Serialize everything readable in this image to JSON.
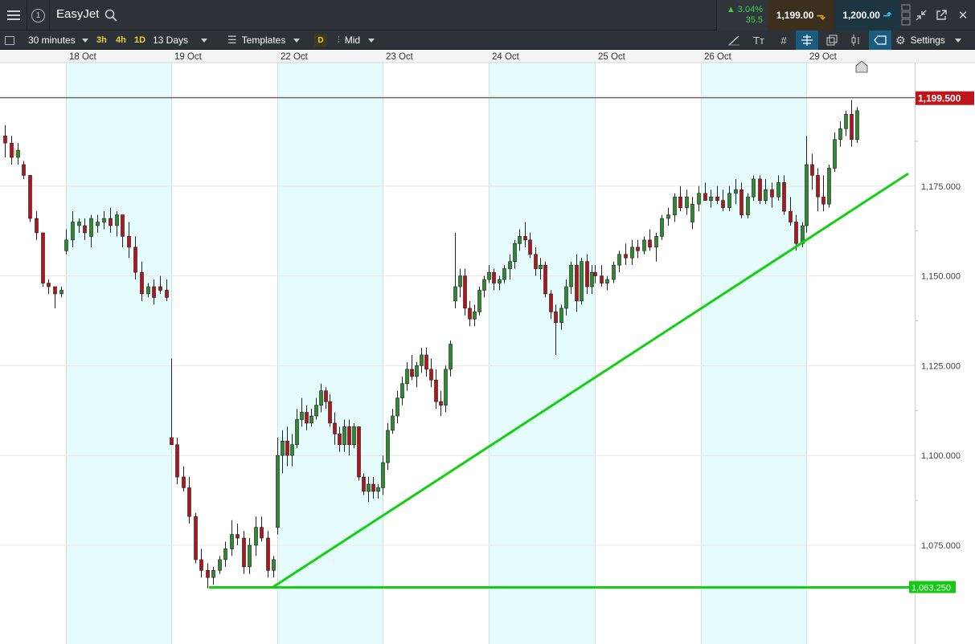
{
  "header": {
    "instrument": "EasyJet",
    "info_label": "1",
    "change_pct": "▲ 3.04%",
    "change_pts": "35.5",
    "sell_price": "1,199.00",
    "buy_price": "1,200.00",
    "icons": [
      "menu-icon",
      "info-icon",
      "search-icon",
      "arrow-down-icon",
      "arrow-up-icon",
      "ladder-icon",
      "shrink-icon",
      "popout-icon",
      "close-icon"
    ]
  },
  "toolbar": {
    "interval": "30 minutes",
    "quick_intervals": [
      "3h",
      "4h",
      "1D"
    ],
    "range": "13 Days",
    "templates": "Templates",
    "d_badge": "D",
    "price_type": "Mid",
    "settings": "Settings",
    "tools": [
      "line-draw-icon",
      "text-icon",
      "grid-icon",
      "crosshair-icon",
      "layers-icon",
      "candle-icon",
      "price-tag-icon",
      "settings-icon"
    ]
  },
  "chart_data": {
    "type": "candlestick",
    "date_labels": [
      "18 Oct",
      "19 Oct",
      "22 Oct",
      "23 Oct",
      "24 Oct",
      "25 Oct",
      "26 Oct",
      "29 Oct"
    ],
    "y_ticks": [
      "1,200.000",
      "1,175.000",
      "1,150.000",
      "1,125.000",
      "1,100.000",
      "1,075.000"
    ],
    "ylim": [
      1043,
      1205
    ],
    "current_price_label": "1,199.500",
    "current_price": 1199.5,
    "support_label": "1,063.250",
    "support_level": 1063.25,
    "trendline": {
      "from_price": 1063.25,
      "to_price": 1178.5
    },
    "colors": {
      "up": "#2f8a2f",
      "down": "#b3141b",
      "trend": "#14d014",
      "session_shade": "#e6fcfc",
      "current_tag": "#c0141b",
      "support_tag": "#14c814"
    },
    "candles": [
      [
        1189,
        1192,
        1183,
        1187
      ],
      [
        1187,
        1189,
        1181,
        1183
      ],
      [
        1183,
        1187,
        1181,
        1185
      ],
      [
        1181,
        1182,
        1177,
        1178
      ],
      [
        1178,
        1178,
        1165,
        1166
      ],
      [
        1166,
        1168,
        1160,
        1162
      ],
      [
        1162,
        1162,
        1147,
        1148
      ],
      [
        1148,
        1149,
        1145,
        1147
      ],
      [
        1147,
        1147,
        1141,
        1145
      ],
      [
        1145,
        1147,
        1144,
        1146
      ],
      [
        1157,
        1163,
        1156,
        1160
      ],
      [
        1160,
        1168,
        1158,
        1165
      ],
      [
        1164,
        1166,
        1162,
        1165
      ],
      [
        1164,
        1166,
        1160,
        1162
      ],
      [
        1161,
        1167,
        1158,
        1166
      ],
      [
        1164,
        1167,
        1162,
        1165
      ],
      [
        1165,
        1168,
        1163,
        1166
      ],
      [
        1166,
        1169,
        1162,
        1164
      ],
      [
        1164,
        1168,
        1161,
        1167
      ],
      [
        1167,
        1167,
        1158,
        1161
      ],
      [
        1161,
        1165,
        1155,
        1158
      ],
      [
        1158,
        1161,
        1149,
        1151
      ],
      [
        1151,
        1154,
        1143,
        1145
      ],
      [
        1145,
        1148,
        1144,
        1147
      ],
      [
        1147,
        1149,
        1142,
        1144
      ],
      [
        1147,
        1150,
        1145,
        1146
      ],
      [
        1146,
        1149,
        1143,
        1144
      ],
      [
        1105,
        1127,
        1103,
        1103
      ],
      [
        1103,
        1105,
        1092,
        1094
      ],
      [
        1094,
        1097,
        1090,
        1091
      ],
      [
        1091,
        1094,
        1081,
        1083
      ],
      [
        1083,
        1084,
        1070,
        1071
      ],
      [
        1071,
        1074,
        1066,
        1068
      ],
      [
        1068,
        1070,
        1063,
        1066
      ],
      [
        1066,
        1069,
        1064,
        1068
      ],
      [
        1068,
        1072,
        1067,
        1071
      ],
      [
        1071,
        1076,
        1069,
        1074
      ],
      [
        1074,
        1082,
        1072,
        1078
      ],
      [
        1078,
        1081,
        1075,
        1077
      ],
      [
        1077,
        1079,
        1067,
        1069
      ],
      [
        1069,
        1077,
        1067,
        1075
      ],
      [
        1075,
        1083,
        1072,
        1080
      ],
      [
        1080,
        1083,
        1076,
        1077
      ],
      [
        1077,
        1079,
        1066,
        1068
      ],
      [
        1068,
        1072,
        1066,
        1071
      ],
      [
        1080,
        1105,
        1078,
        1100
      ],
      [
        1100,
        1107,
        1095,
        1104
      ],
      [
        1104,
        1108,
        1097,
        1100
      ],
      [
        1100,
        1106,
        1097,
        1103
      ],
      [
        1103,
        1113,
        1102,
        1110
      ],
      [
        1110,
        1116,
        1108,
        1112
      ],
      [
        1112,
        1114,
        1107,
        1109
      ],
      [
        1109,
        1113,
        1108,
        1111
      ],
      [
        1111,
        1116,
        1110,
        1114
      ],
      [
        1114,
        1120,
        1112,
        1118
      ],
      [
        1118,
        1119,
        1113,
        1115
      ],
      [
        1115,
        1117,
        1108,
        1109
      ],
      [
        1109,
        1112,
        1103,
        1106
      ],
      [
        1106,
        1108,
        1101,
        1103
      ],
      [
        1103,
        1110,
        1101,
        1108
      ],
      [
        1108,
        1110,
        1100,
        1103
      ],
      [
        1103,
        1109,
        1102,
        1108
      ],
      [
        1108,
        1108,
        1093,
        1094
      ],
      [
        1094,
        1095,
        1089,
        1090
      ],
      [
        1090,
        1094,
        1087,
        1092
      ],
      [
        1092,
        1094,
        1088,
        1090
      ],
      [
        1090,
        1092,
        1088,
        1091
      ],
      [
        1091,
        1100,
        1089,
        1098
      ],
      [
        1098,
        1109,
        1096,
        1107
      ],
      [
        1107,
        1113,
        1106,
        1111
      ],
      [
        1111,
        1118,
        1109,
        1116
      ],
      [
        1116,
        1122,
        1114,
        1120
      ],
      [
        1120,
        1126,
        1118,
        1124
      ],
      [
        1124,
        1128,
        1121,
        1122
      ],
      [
        1122,
        1126,
        1119,
        1125
      ],
      [
        1125,
        1130,
        1123,
        1128
      ],
      [
        1128,
        1130,
        1122,
        1124
      ],
      [
        1124,
        1127,
        1119,
        1121
      ],
      [
        1121,
        1124,
        1113,
        1115
      ],
      [
        1115,
        1118,
        1111,
        1114
      ],
      [
        1114,
        1125,
        1112,
        1124
      ],
      [
        1124,
        1132,
        1122,
        1131
      ],
      [
        1143,
        1162,
        1141,
        1147
      ],
      [
        1147,
        1152,
        1144,
        1150
      ],
      [
        1150,
        1152,
        1139,
        1141
      ],
      [
        1141,
        1143,
        1136,
        1138
      ],
      [
        1138,
        1142,
        1136,
        1140
      ],
      [
        1140,
        1147,
        1139,
        1146
      ],
      [
        1146,
        1150,
        1144,
        1149
      ],
      [
        1149,
        1153,
        1148,
        1151
      ],
      [
        1151,
        1152,
        1146,
        1148
      ],
      [
        1148,
        1150,
        1146,
        1149
      ],
      [
        1149,
        1153,
        1148,
        1152
      ],
      [
        1152,
        1156,
        1149,
        1154
      ],
      [
        1154,
        1160,
        1152,
        1159
      ],
      [
        1159,
        1163,
        1157,
        1161
      ],
      [
        1161,
        1165,
        1158,
        1160
      ],
      [
        1160,
        1162,
        1155,
        1156
      ],
      [
        1156,
        1158,
        1150,
        1152
      ],
      [
        1152,
        1155,
        1149,
        1153
      ],
      [
        1153,
        1154,
        1144,
        1145
      ],
      [
        1145,
        1146,
        1138,
        1140
      ],
      [
        1140,
        1142,
        1128,
        1137
      ],
      [
        1137,
        1142,
        1135,
        1141
      ],
      [
        1141,
        1149,
        1139,
        1147
      ],
      [
        1147,
        1154,
        1145,
        1153
      ],
      [
        1153,
        1156,
        1140,
        1143
      ],
      [
        1143,
        1155,
        1142,
        1154
      ],
      [
        1154,
        1156,
        1145,
        1147
      ],
      [
        1147,
        1153,
        1145,
        1151
      ],
      [
        1151,
        1153,
        1148,
        1150
      ],
      [
        1150,
        1153,
        1147,
        1148
      ],
      [
        1148,
        1150,
        1146,
        1149
      ],
      [
        1149,
        1154,
        1148,
        1153
      ],
      [
        1153,
        1157,
        1151,
        1156
      ],
      [
        1156,
        1159,
        1153,
        1155
      ],
      [
        1155,
        1160,
        1153,
        1158
      ],
      [
        1158,
        1160,
        1155,
        1157
      ],
      [
        1157,
        1161,
        1156,
        1160
      ],
      [
        1160,
        1163,
        1157,
        1158
      ],
      [
        1158,
        1162,
        1154,
        1161
      ],
      [
        1161,
        1167,
        1160,
        1166
      ],
      [
        1166,
        1169,
        1164,
        1167
      ],
      [
        1167,
        1173,
        1165,
        1172
      ],
      [
        1172,
        1175,
        1168,
        1169
      ],
      [
        1169,
        1174,
        1167,
        1172
      ],
      [
        1165,
        1172,
        1163,
        1170
      ],
      [
        1170,
        1175,
        1168,
        1173
      ],
      [
        1173,
        1176,
        1171,
        1171
      ],
      [
        1171,
        1174,
        1169,
        1172
      ],
      [
        1172,
        1175,
        1170,
        1171
      ],
      [
        1171,
        1174,
        1168,
        1169
      ],
      [
        1169,
        1175,
        1168,
        1173
      ],
      [
        1173,
        1177,
        1170,
        1174
      ],
      [
        1174,
        1176,
        1166,
        1167
      ],
      [
        1167,
        1173,
        1166,
        1172
      ],
      [
        1172,
        1178,
        1171,
        1177
      ],
      [
        1177,
        1178,
        1170,
        1171
      ],
      [
        1171,
        1177,
        1170,
        1174
      ],
      [
        1174,
        1176,
        1169,
        1172
      ],
      [
        1172,
        1178,
        1171,
        1176
      ],
      [
        1176,
        1178,
        1167,
        1168
      ],
      [
        1168,
        1172,
        1164,
        1165
      ],
      [
        1165,
        1167,
        1157,
        1159
      ],
      [
        1159,
        1165,
        1158,
        1164
      ],
      [
        1164,
        1189,
        1162,
        1181
      ],
      [
        1181,
        1184,
        1174,
        1178
      ],
      [
        1178,
        1180,
        1168,
        1172
      ],
      [
        1172,
        1178,
        1168,
        1170
      ],
      [
        1170,
        1181,
        1169,
        1180
      ],
      [
        1180,
        1190,
        1179,
        1188
      ],
      [
        1188,
        1193,
        1186,
        1191
      ],
      [
        1191,
        1196,
        1189,
        1195
      ],
      [
        1195,
        1199,
        1186,
        1188
      ],
      [
        1188,
        1197,
        1187,
        1196
      ]
    ]
  }
}
